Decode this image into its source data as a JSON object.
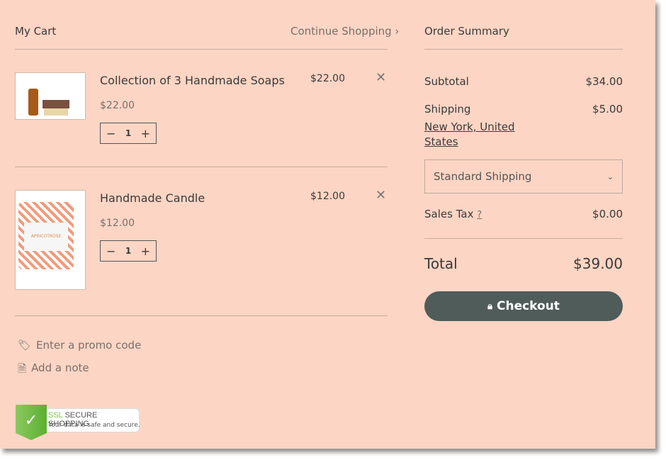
{
  "cart": {
    "title": "My Cart",
    "continue": "Continue Shopping ›",
    "items": [
      {
        "name": "Collection of 3 Handmade Soaps",
        "unit_price": "$22.00",
        "total": "$22.00",
        "qty": "1"
      },
      {
        "name": "Handmade Candle",
        "unit_price": "$12.00",
        "total": "$12.00",
        "qty": "1",
        "label": "APRICOTROSE"
      }
    ],
    "promo": "Enter a promo code",
    "note": "Add a note"
  },
  "summary": {
    "title": "Order Summary",
    "subtotal_label": "Subtotal",
    "subtotal": "$34.00",
    "shipping_label": "Shipping",
    "shipping": "$5.00",
    "location": "New York, United States",
    "shipping_option": "Standard Shipping",
    "tax_label": "Sales Tax",
    "tax_help": "?",
    "tax": "$0.00",
    "total_label": "Total",
    "total": "$39.00",
    "checkout": "Checkout"
  },
  "badge": {
    "ssl": "SSL",
    "secure": "SECURE SHOPPING",
    "sub": "Your data is safe and secure."
  },
  "colors": {
    "background": "#fcd5c4",
    "checkout": "#505c5a",
    "badge_green": "#5bb030"
  }
}
